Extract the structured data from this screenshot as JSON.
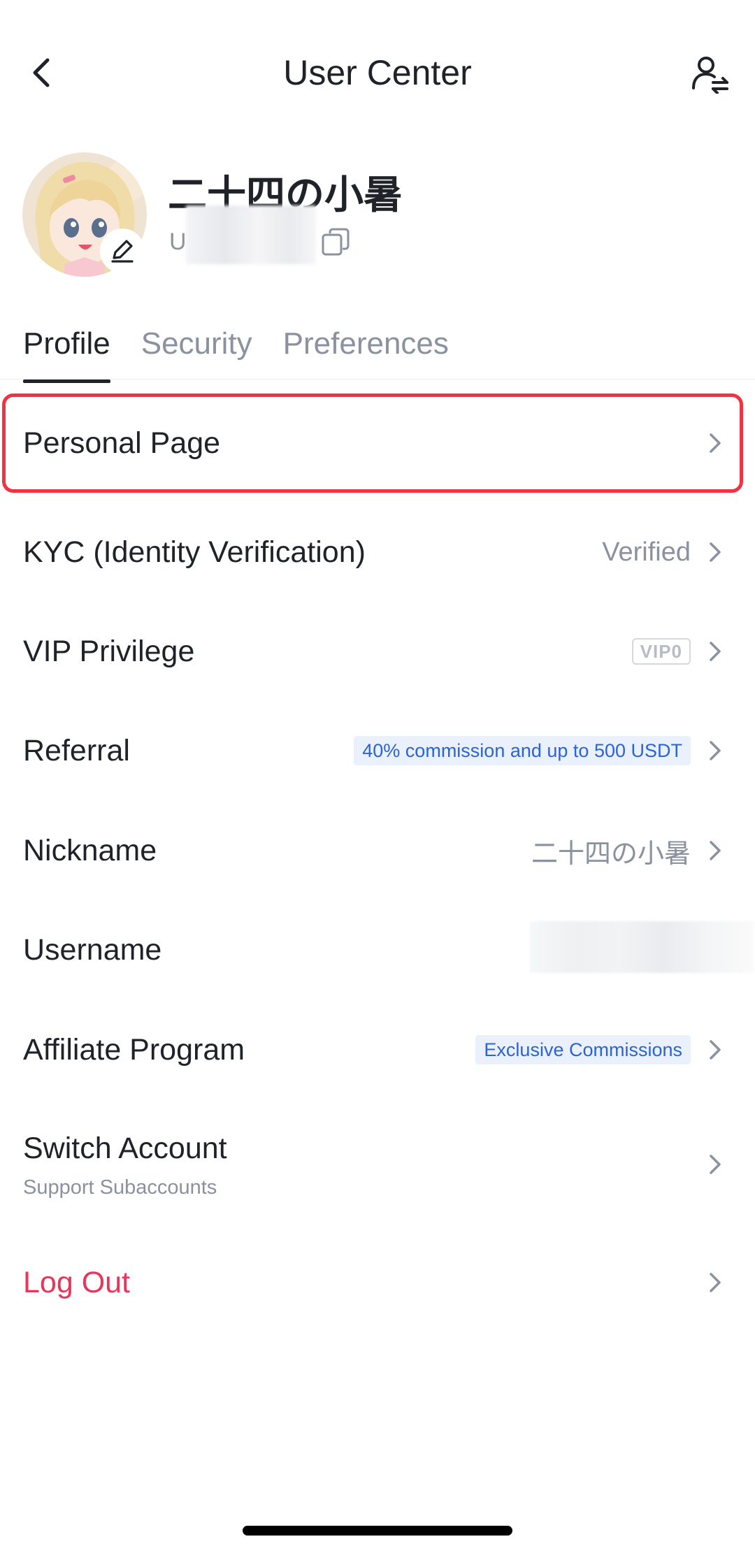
{
  "header": {
    "title": "User Center",
    "back_icon": "chevron-left-icon",
    "right_icon": "user-switch-icon"
  },
  "profile": {
    "nickname": "二十四の小暑",
    "uid_prefix": "U",
    "avatar_icon": "anime-avatar",
    "edit_icon": "pencil-icon",
    "copy_icon": "copy-icon"
  },
  "tabs": [
    {
      "label": "Profile",
      "active": true
    },
    {
      "label": "Security",
      "active": false
    },
    {
      "label": "Preferences",
      "active": false
    }
  ],
  "menu": {
    "personal_page": {
      "label": "Personal Page"
    },
    "kyc": {
      "label": "KYC (Identity Verification)",
      "value": "Verified"
    },
    "vip": {
      "label": "VIP Privilege",
      "badge": "VIP0"
    },
    "referral": {
      "label": "Referral",
      "badge": "40% commission and up to 500 USDT"
    },
    "nickname": {
      "label": "Nickname",
      "value": "二十四の小暑"
    },
    "username": {
      "label": "Username"
    },
    "affiliate": {
      "label": "Affiliate Program",
      "badge": "Exclusive Commissions"
    },
    "switch_account": {
      "label": "Switch Account",
      "sub": "Support Subaccounts"
    },
    "logout": {
      "label": "Log Out"
    }
  },
  "colors": {
    "accent_red": "#e8355a",
    "highlight_border": "#f03341",
    "badge_blue": "#2b63d9",
    "badge_bg": "#eaf1fc",
    "muted": "#8a919f"
  }
}
